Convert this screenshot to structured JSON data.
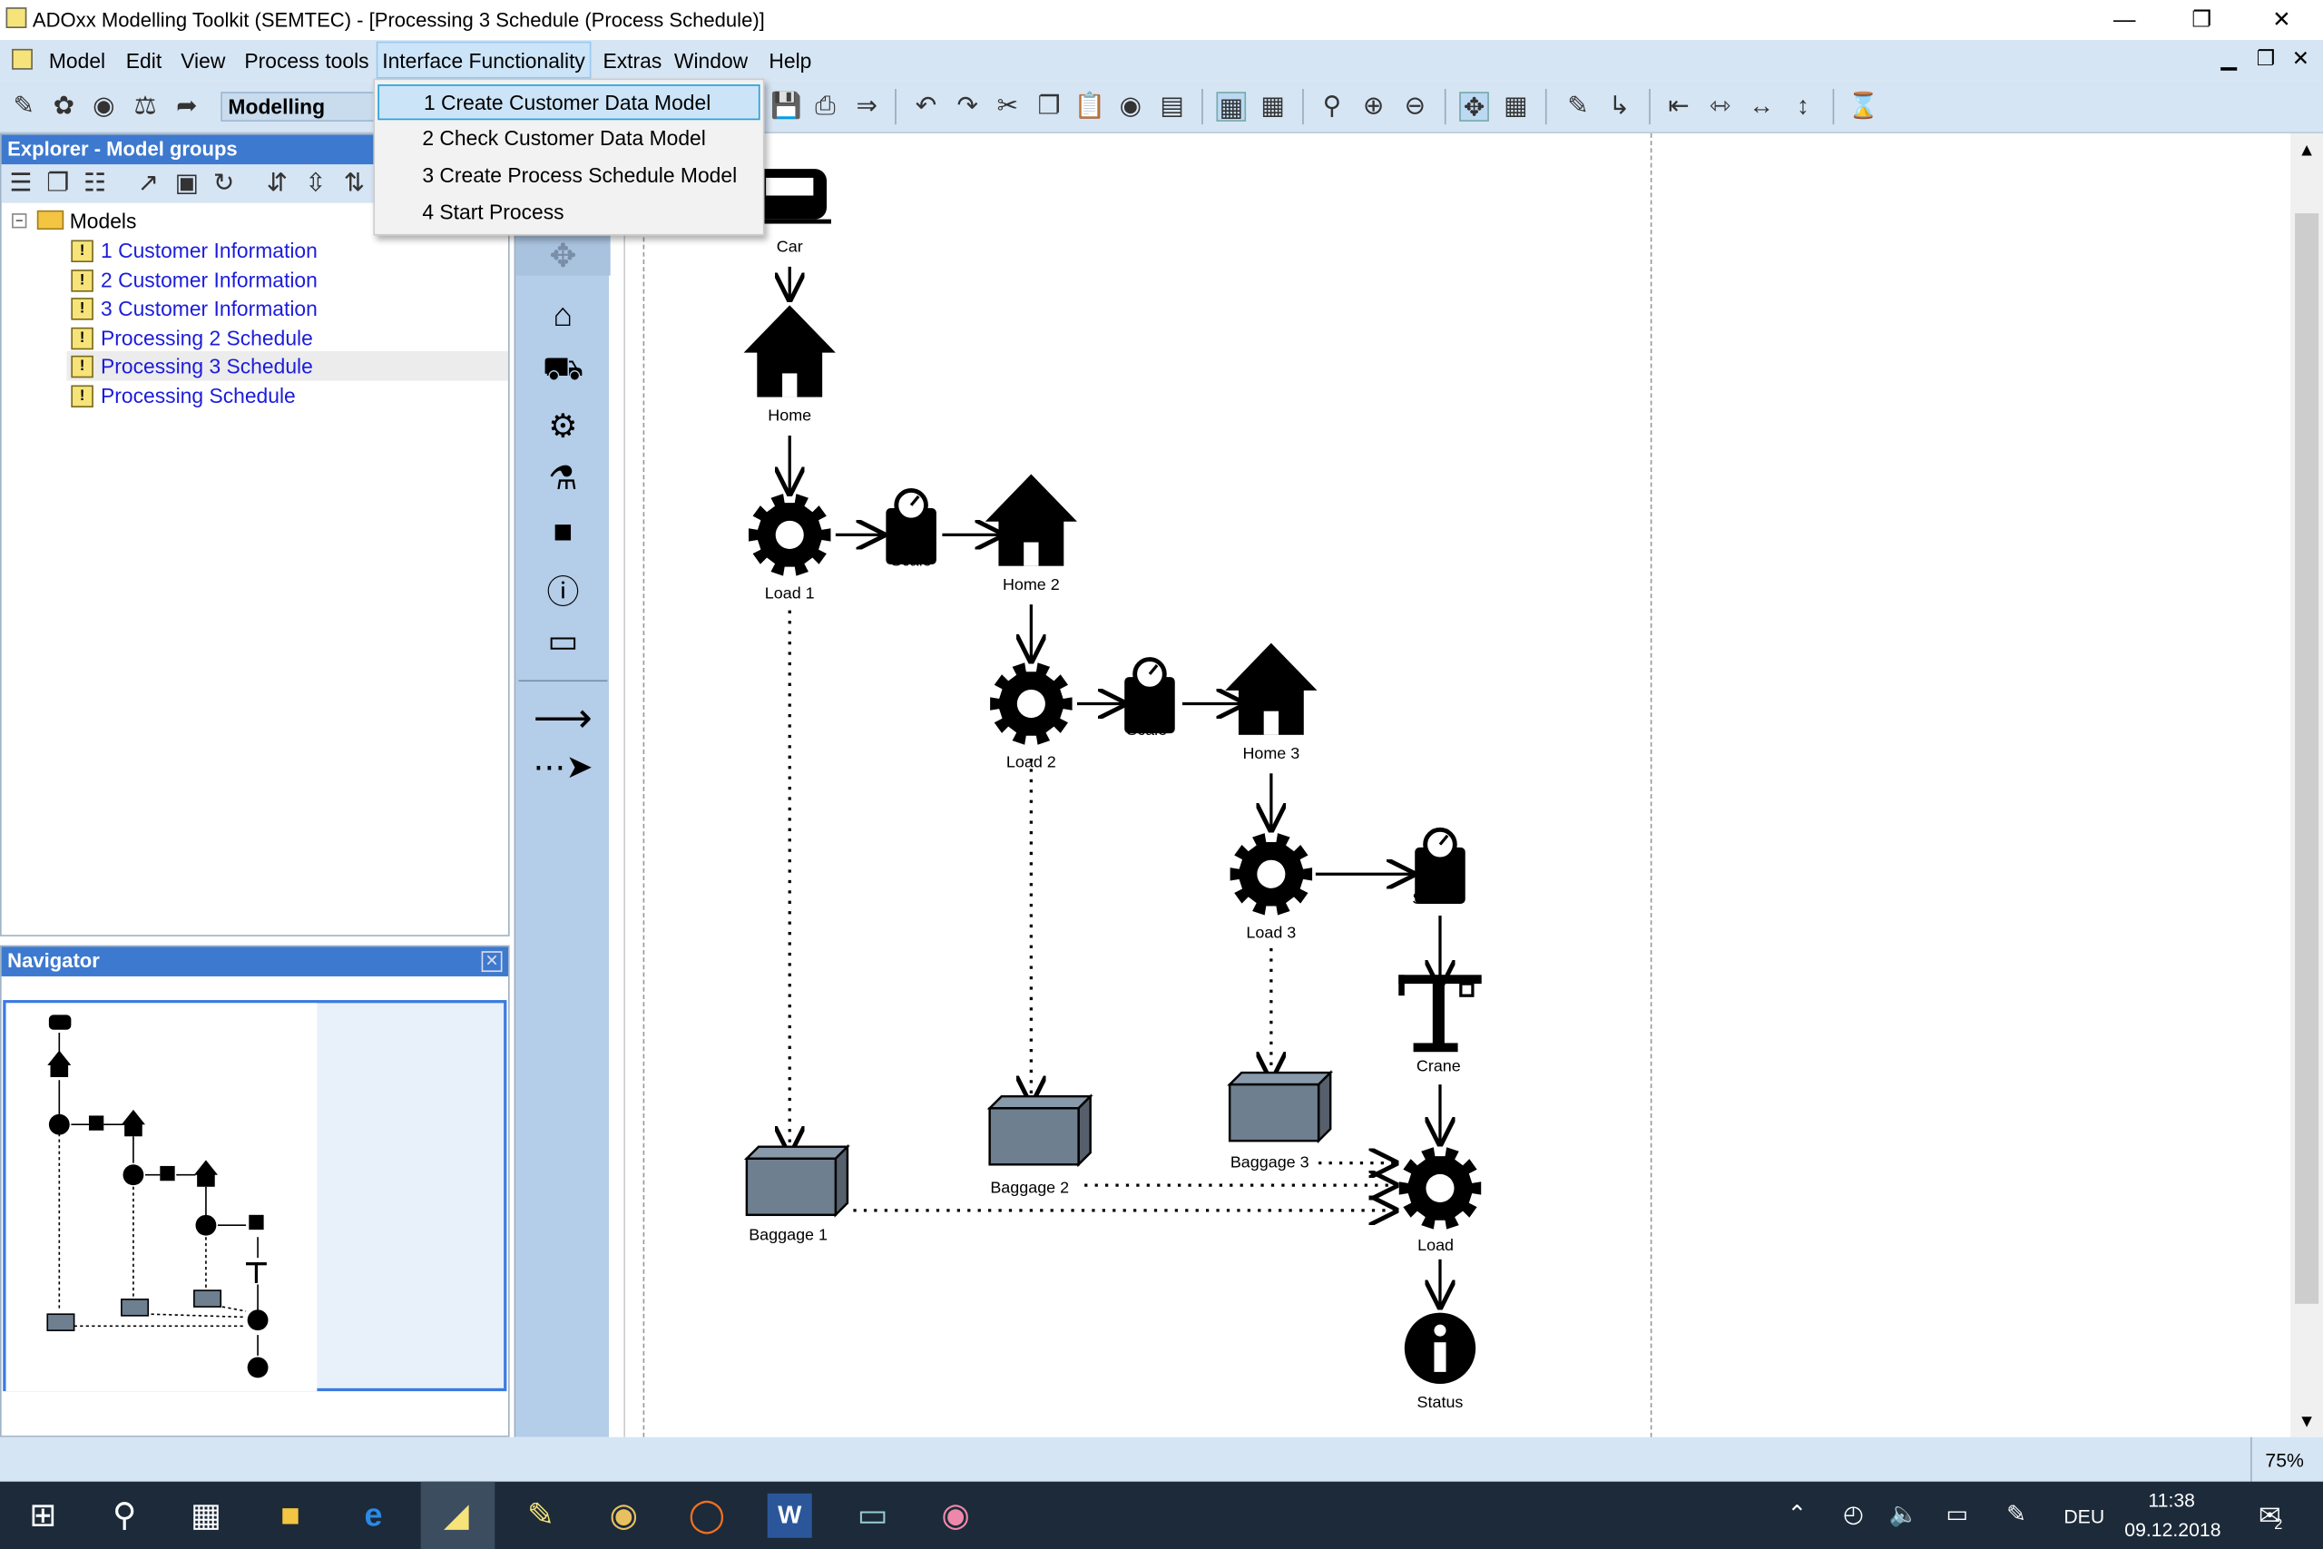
{
  "window": {
    "title": "ADOxx Modelling Toolkit (SEMTEC) - [Processing 3 Schedule (Process Schedule)]"
  },
  "menu": {
    "items": [
      "Model",
      "Edit",
      "View",
      "Process tools",
      "Interface Functionality",
      "Extras",
      "Window",
      "Help"
    ]
  },
  "toolbar": {
    "mode": "Modelling"
  },
  "dropdown": {
    "items": [
      "1 Create Customer Data Model",
      "2 Check Customer Data Model",
      "3 Create Process Schedule Model",
      "4 Start Process"
    ]
  },
  "explorer": {
    "title": "Explorer - Model groups",
    "root": "Models",
    "items": [
      "1 Customer Information",
      "2 Customer Information",
      "3 Customer Information",
      "Processing 2 Schedule",
      "Processing 3 Schedule",
      "Processing Schedule"
    ],
    "selected": "Processing 3 Schedule"
  },
  "navigator": {
    "title": "Navigator"
  },
  "diagram": {
    "nodes": [
      {
        "label": "Car",
        "kind": "car"
      },
      {
        "label": "Home",
        "kind": "home"
      },
      {
        "label": "Load 1",
        "kind": "gear"
      },
      {
        "label": "Scale",
        "kind": "scale"
      },
      {
        "label": "Home 2",
        "kind": "home"
      },
      {
        "label": "Load 2",
        "kind": "gear"
      },
      {
        "label": "Scale",
        "kind": "scale"
      },
      {
        "label": "Home 3",
        "kind": "home"
      },
      {
        "label": "Load 3",
        "kind": "gear"
      },
      {
        "label": "Scale",
        "kind": "scale"
      },
      {
        "label": "Crane",
        "kind": "crane"
      },
      {
        "label": "Load",
        "kind": "gear"
      },
      {
        "label": "Status",
        "kind": "info"
      },
      {
        "label": "Baggage 1",
        "kind": "box"
      },
      {
        "label": "Baggage 2",
        "kind": "box"
      },
      {
        "label": "Baggage 3",
        "kind": "box"
      }
    ]
  },
  "statusbar": {
    "zoom": "75%"
  },
  "taskbar": {
    "lang": "DEU",
    "time": "11:38",
    "date": "09.12.2018",
    "notifications": "2"
  }
}
